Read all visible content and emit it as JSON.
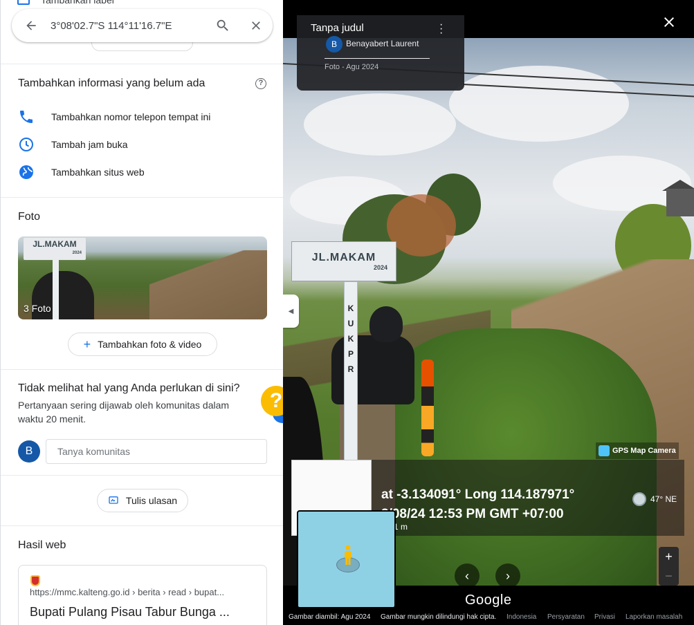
{
  "left_panel": {
    "peek_label": "Tambahkan label",
    "search": {
      "query": "3°08'02.7\"S 114°11'16.7\"E"
    },
    "add_info": {
      "title": "Tambahkan informasi yang belum ada",
      "rows": [
        {
          "icon": "phone-icon",
          "label": "Tambahkan nomor telepon tempat ini"
        },
        {
          "icon": "clock-icon",
          "label": "Tambah jam buka"
        },
        {
          "icon": "globe-icon",
          "label": "Tambahkan situs web"
        }
      ]
    },
    "photos": {
      "title": "Foto",
      "sign_text": "JL.MAKAM",
      "sign_year": "2024",
      "count_label": "3 Foto",
      "add_button": "Tambahkan foto & video"
    },
    "community": {
      "title": "Tidak melihat hal yang Anda perlukan di sini?",
      "subtitle": "Pertanyaan sering dijawab oleh komunitas dalam waktu 20 menit.",
      "avatar_letter": "B",
      "input_placeholder": "Tanya komunitas",
      "help_mark": "?"
    },
    "review_button": "Tulis ulasan",
    "web": {
      "title": "Hasil web",
      "url": "https://mmc.kalteng.go.id › berita › read › bupat...",
      "result_title": "Bupati Pulang Pisau Tabur Bunga ..."
    }
  },
  "viewer": {
    "info_title": "Tanpa judul",
    "author_letter": "B",
    "author_name": "Benayabert Laurent",
    "date": "Foto - Agu 2024",
    "sign_text": "JL.MAKAM",
    "sign_year": "2024",
    "pole_letters": [
      "K",
      "U",
      "K",
      "P",
      "R"
    ],
    "gps_brand": "GPS Map Camera",
    "gps_line1": "at -3.134091° Long 114.187971°",
    "gps_line2": "3/08/24 12:53 PM GMT +07:00",
    "gps_scale": "1 m",
    "compass": "47° NE",
    "google_label": "Google",
    "zoom_in": "+",
    "zoom_out": "−",
    "footer": [
      "Gambar diambil: Agu 2024",
      "Gambar mungkin dilindungi hak cipta.",
      "Indonesia",
      "Persyaratan",
      "Privasi",
      "Laporkan masalah"
    ]
  },
  "colors": {
    "accent": "#1a73e8",
    "avatar": "#1558a7",
    "help_yellow": "#fbbc04",
    "minimap": "#8fd1e4"
  }
}
